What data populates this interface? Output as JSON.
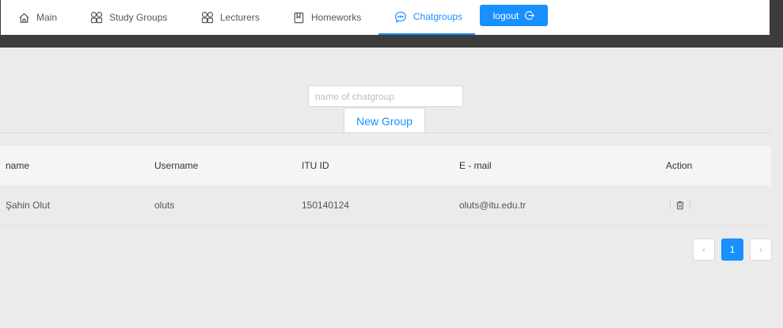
{
  "nav": {
    "items": [
      {
        "label": "Main",
        "icon": "home-icon"
      },
      {
        "label": "Study Groups",
        "icon": "apps-icon"
      },
      {
        "label": "Lecturers",
        "icon": "apps-icon"
      },
      {
        "label": "Homeworks",
        "icon": "book-icon"
      },
      {
        "label": "Chatgroups",
        "icon": "chat-icon",
        "active": true
      }
    ],
    "logout_label": "logout"
  },
  "search": {
    "placeholder": "name of chatgroup",
    "value": ""
  },
  "new_group_label": "New Group",
  "table": {
    "columns": [
      "name",
      "Username",
      "ITU ID",
      "E - mail",
      "Action"
    ],
    "rows": [
      {
        "name": "Şahin Olut",
        "username": "oluts",
        "itu_id": "150140124",
        "email": "oluts@itu.edu.tr"
      }
    ]
  },
  "pagination": {
    "prev": "‹",
    "current": "1",
    "next": "›"
  },
  "colors": {
    "accent": "#1890ff",
    "topbar": "#3c3c3c",
    "background": "#ebebeb"
  }
}
